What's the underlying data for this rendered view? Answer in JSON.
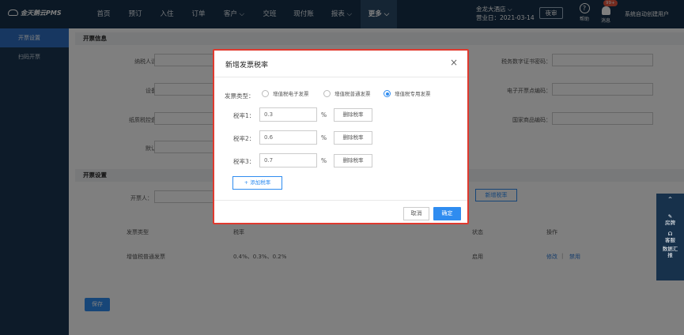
{
  "brand": {
    "name": "金天鹅云PMS"
  },
  "nav": [
    {
      "label": "首页"
    },
    {
      "label": "预订"
    },
    {
      "label": "入住"
    },
    {
      "label": "订单"
    },
    {
      "label": "客户 ⌵"
    },
    {
      "label": "交班"
    },
    {
      "label": "现付账"
    },
    {
      "label": "报表 ⌵"
    },
    {
      "label": "更多 ⌵"
    }
  ],
  "header": {
    "hotel_name": "金龙大酒店 ⌵",
    "business_date": "营业日：2021-03-14",
    "night_audit": "夜审",
    "help": "帮助",
    "messages": "消息",
    "badge": "99+",
    "user": "系统自动创建用户"
  },
  "sidebar": {
    "items": [
      {
        "label": "开票设置"
      },
      {
        "label": "扫码开票"
      }
    ]
  },
  "invoice_info": {
    "title": "开票信息",
    "taxpayer_id": "纳税人识别号：",
    "device_type": "设备类型：",
    "paper_disk_no": "纸质税控盘编号：",
    "default_rate": "默认税率：",
    "tax_cert_pwd": "税务数字证书密码：",
    "e_invoice_no": "电子开票点编码：",
    "national_code": "国家商品编码："
  },
  "invoice_settings": {
    "title": "开票设置",
    "issuer_label": "开票人：",
    "add_rate_btn": "新增税率",
    "columns": {
      "type": "发票类型",
      "rate": "税率",
      "status": "状态",
      "action": "操作"
    },
    "rows": [
      {
        "type": "增值税普通发票",
        "rate": "0.4%、0.3%、0.2%",
        "status": "启用",
        "edit": "修改",
        "sep": "|",
        "disable": "禁用"
      }
    ],
    "save": "保存"
  },
  "right_tools": {
    "top": "^",
    "items": [
      {
        "label": "房牌"
      },
      {
        "label": "客服"
      },
      {
        "label": "数据汇报"
      }
    ]
  },
  "modal": {
    "title": "新增发票税率",
    "close": "×",
    "type_label": "发票类型：",
    "types": [
      {
        "label": "增值税电子发票",
        "checked": false
      },
      {
        "label": "增值税普通发票",
        "checked": false
      },
      {
        "label": "增值税专用发票",
        "checked": true
      }
    ],
    "rates": [
      {
        "label": "税率1：",
        "value": "0.3",
        "unit": "%",
        "delete": "删除税率"
      },
      {
        "label": "税率2：",
        "value": "0.6",
        "unit": "%",
        "delete": "删除税率"
      },
      {
        "label": "税率3：",
        "value": "0.7",
        "unit": "%",
        "delete": "删除税率"
      }
    ],
    "add_rate": "+ 添加税率",
    "cancel": "取消",
    "confirm": "确定"
  },
  "colors": {
    "topbar": "#17314b",
    "sidebar": "#1b3652",
    "accent": "#2f8cf0",
    "highlight_border": "#e03a2f"
  }
}
